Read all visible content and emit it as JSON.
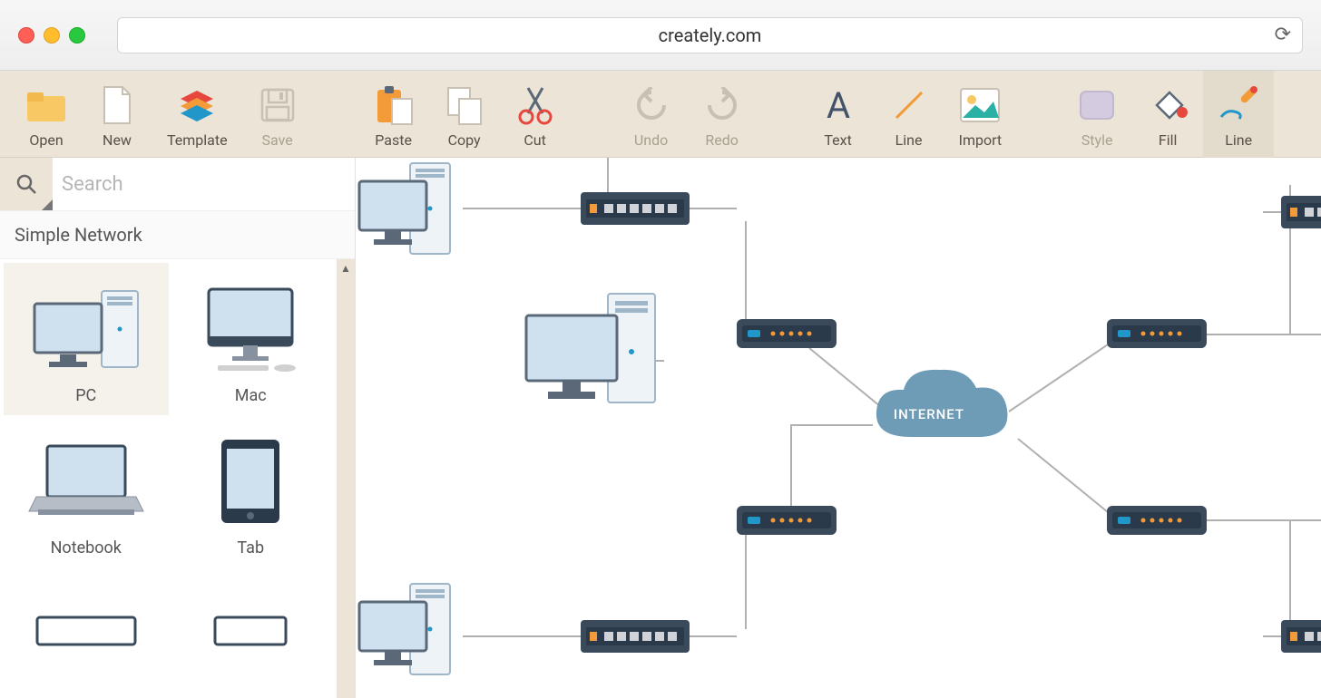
{
  "browser": {
    "url": "creately.com"
  },
  "toolbar": {
    "open": "Open",
    "new": "New",
    "template": "Template",
    "save": "Save",
    "paste": "Paste",
    "copy": "Copy",
    "cut": "Cut",
    "undo": "Undo",
    "redo": "Redo",
    "text": "Text",
    "line": "Line",
    "import": "Import",
    "style": "Style",
    "fill": "Fill",
    "line2": "Line"
  },
  "sidebar": {
    "search_placeholder": "Search",
    "library_title": "Simple Network",
    "items": [
      {
        "label": "PC"
      },
      {
        "label": "Mac"
      },
      {
        "label": "Notebook"
      },
      {
        "label": "Tab"
      }
    ]
  },
  "canvas": {
    "cloud_label": "INTERNET"
  }
}
